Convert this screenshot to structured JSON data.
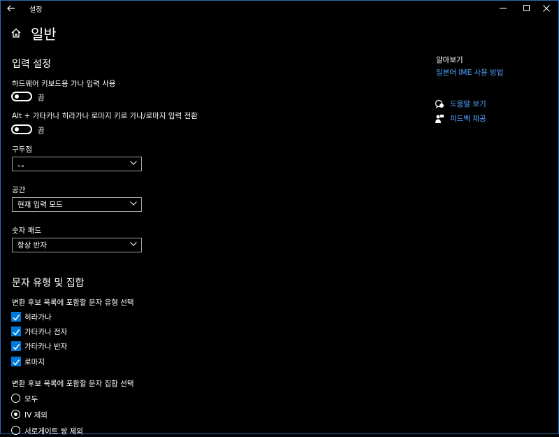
{
  "app": {
    "title": "설정"
  },
  "page": {
    "title": "일반"
  },
  "input_settings": {
    "title": "입력 설정",
    "hardware_kana": {
      "label": "하드웨어 키보드용 가나 입력 사용",
      "state": "끔"
    },
    "alt_toggle": {
      "label": "Alt + 가타카나 히라가나 로마지 키로 가나/로마지 입력 전환",
      "state": "끔"
    },
    "punctuation": {
      "label": "구두점",
      "value": "、。"
    },
    "space": {
      "label": "공간",
      "value": "현재 입력 모드"
    },
    "numpad": {
      "label": "숫자 패드",
      "value": "항상 반자"
    }
  },
  "char_types": {
    "title": "문자 유형 및 집합",
    "type_prompt": "변환 후보 목록에 포함할 문자 유형 선택",
    "types": [
      {
        "label": "히라가나",
        "checked": true
      },
      {
        "label": "가타카나 전자",
        "checked": true
      },
      {
        "label": "가타카나 반자",
        "checked": true
      },
      {
        "label": "로마지",
        "checked": true
      }
    ],
    "set_prompt": "변환 후보 목록에 포함할 문자 집합 선택",
    "sets": [
      {
        "label": "모두",
        "selected": false
      },
      {
        "label": "IV 제외",
        "selected": true
      },
      {
        "label": "서로게이트 쌍 제외",
        "selected": false
      }
    ]
  },
  "right_panel": {
    "heading": "알아보기",
    "link": "일본어 IME 사용 방법",
    "help": "도움말 보기",
    "feedback": "피드백 제공"
  },
  "colors": {
    "accent": "#0078d7",
    "link": "#4fa3ff",
    "background": "#000000",
    "border": "#2b6cb5"
  },
  "icons": [
    "back-arrow-icon",
    "minimize-icon",
    "maximize-icon",
    "close-icon",
    "home-icon",
    "chevron-down-icon",
    "checkmark-icon",
    "help-chat-icon",
    "feedback-person-icon"
  ]
}
